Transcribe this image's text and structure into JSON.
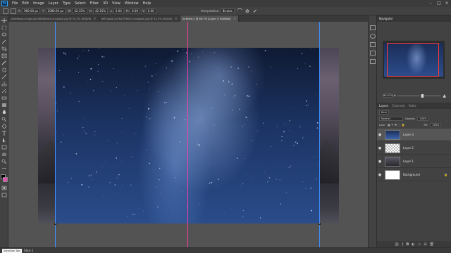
{
  "menubar": {
    "items": [
      "File",
      "Edit",
      "Image",
      "Layer",
      "Type",
      "Select",
      "Filter",
      "3D",
      "View",
      "Window",
      "Help"
    ],
    "logo": "Ps"
  },
  "options": {
    "x_label": "X:",
    "x_val": "960.00 px",
    "y_label": "Y:",
    "y_val": "1080.00 px",
    "w_label": "W:",
    "w_val": "42.15%",
    "h_label": "H:",
    "h_val": "42.15%",
    "angle_label": "∠",
    "angle_val": "0.00",
    "hskew_label": "H:",
    "hskew_val": "0.00",
    "vskew_label": "V:",
    "vskew_val": "0.00",
    "interp_label": "Interpolation:",
    "interp_val": "Bicubic"
  },
  "tabs": [
    {
      "label": "cheeftown-mage-ptl2A8G8sFork-unsplash.jpg @ 33.3% (RGB/8)",
      "active": false
    },
    {
      "label": "jeff-hopkin-kF3sjTFH8OU-unsplash.jpg @ 33.3% (RGB/8)",
      "active": false
    },
    {
      "label": "Untitled-1 @ 66.7% (Layer 3, RGB/8#)",
      "active": true
    }
  ],
  "navigator": {
    "tab": "Navigator",
    "zoom": "66.67%",
    "zoom_level": 0.55
  },
  "layers": {
    "tabs": [
      "Layers",
      "Channels",
      "Paths"
    ],
    "filter_label": "Kind",
    "blend_mode": "Normal",
    "opacity_label": "Opacity:",
    "opacity": "100%",
    "lock_label": "Lock:",
    "fill_label": "Fill:",
    "fill": "100%",
    "rows": [
      {
        "name": "Layer 3",
        "selected": true,
        "thumb": "stars"
      },
      {
        "name": "Layer 2",
        "selected": false,
        "thumb": "transparent"
      },
      {
        "name": "Layer 1",
        "selected": false,
        "thumb": "landscape"
      },
      {
        "name": "Background",
        "selected": false,
        "thumb": "white",
        "lock": "🔒"
      }
    ],
    "bottom_icons": [
      "link-icon",
      "fx-icon",
      "mask-icon",
      "adjustment-icon",
      "group-icon",
      "new-layer-icon",
      "trash-icon"
    ]
  },
  "status": {
    "tooltip": "Selection Tool",
    "zoom": "Slice 1"
  },
  "colors": {
    "guide_left": "#3d8fff",
    "guide_center": "#ff3ba6",
    "foreground": "#000000",
    "background": "#e94fb0"
  }
}
